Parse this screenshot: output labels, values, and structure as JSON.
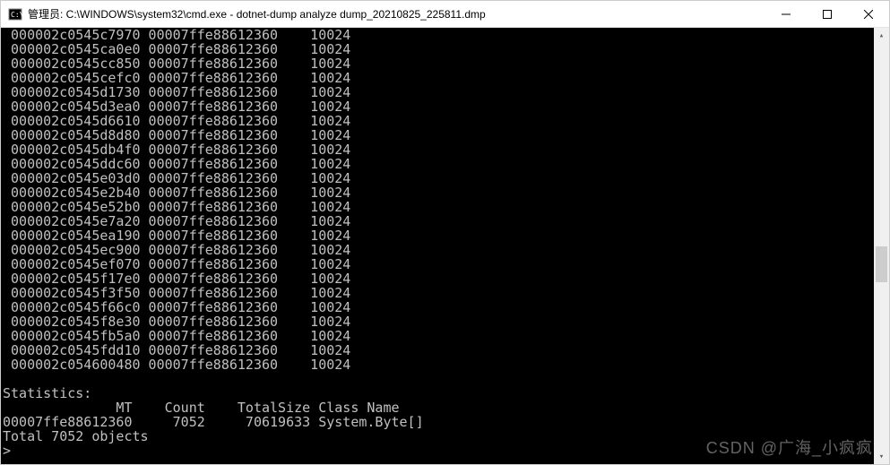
{
  "window": {
    "title": "管理员: C:\\WINDOWS\\system32\\cmd.exe - dotnet-dump  analyze dump_20210825_225811.dmp"
  },
  "rows": [
    {
      "addr": "000002c0545c7970",
      "mt": "00007ffe88612360",
      "size": "10024"
    },
    {
      "addr": "000002c0545ca0e0",
      "mt": "00007ffe88612360",
      "size": "10024"
    },
    {
      "addr": "000002c0545cc850",
      "mt": "00007ffe88612360",
      "size": "10024"
    },
    {
      "addr": "000002c0545cefc0",
      "mt": "00007ffe88612360",
      "size": "10024"
    },
    {
      "addr": "000002c0545d1730",
      "mt": "00007ffe88612360",
      "size": "10024"
    },
    {
      "addr": "000002c0545d3ea0",
      "mt": "00007ffe88612360",
      "size": "10024"
    },
    {
      "addr": "000002c0545d6610",
      "mt": "00007ffe88612360",
      "size": "10024"
    },
    {
      "addr": "000002c0545d8d80",
      "mt": "00007ffe88612360",
      "size": "10024"
    },
    {
      "addr": "000002c0545db4f0",
      "mt": "00007ffe88612360",
      "size": "10024"
    },
    {
      "addr": "000002c0545ddc60",
      "mt": "00007ffe88612360",
      "size": "10024"
    },
    {
      "addr": "000002c0545e03d0",
      "mt": "00007ffe88612360",
      "size": "10024"
    },
    {
      "addr": "000002c0545e2b40",
      "mt": "00007ffe88612360",
      "size": "10024"
    },
    {
      "addr": "000002c0545e52b0",
      "mt": "00007ffe88612360",
      "size": "10024"
    },
    {
      "addr": "000002c0545e7a20",
      "mt": "00007ffe88612360",
      "size": "10024"
    },
    {
      "addr": "000002c0545ea190",
      "mt": "00007ffe88612360",
      "size": "10024"
    },
    {
      "addr": "000002c0545ec900",
      "mt": "00007ffe88612360",
      "size": "10024"
    },
    {
      "addr": "000002c0545ef070",
      "mt": "00007ffe88612360",
      "size": "10024"
    },
    {
      "addr": "000002c0545f17e0",
      "mt": "00007ffe88612360",
      "size": "10024"
    },
    {
      "addr": "000002c0545f3f50",
      "mt": "00007ffe88612360",
      "size": "10024"
    },
    {
      "addr": "000002c0545f66c0",
      "mt": "00007ffe88612360",
      "size": "10024"
    },
    {
      "addr": "000002c0545f8e30",
      "mt": "00007ffe88612360",
      "size": "10024"
    },
    {
      "addr": "000002c0545fb5a0",
      "mt": "00007ffe88612360",
      "size": "10024"
    },
    {
      "addr": "000002c0545fdd10",
      "mt": "00007ffe88612360",
      "size": "10024"
    },
    {
      "addr": "000002c054600480",
      "mt": "00007ffe88612360",
      "size": "10024"
    }
  ],
  "stats": {
    "title": "Statistics:",
    "header": "              MT    Count    TotalSize Class Name",
    "line": "00007ffe88612360     7052     70619633 System.Byte[]",
    "total": "Total 7052 objects"
  },
  "prompt": ">",
  "watermark": "CSDN @广海_小疯疯"
}
